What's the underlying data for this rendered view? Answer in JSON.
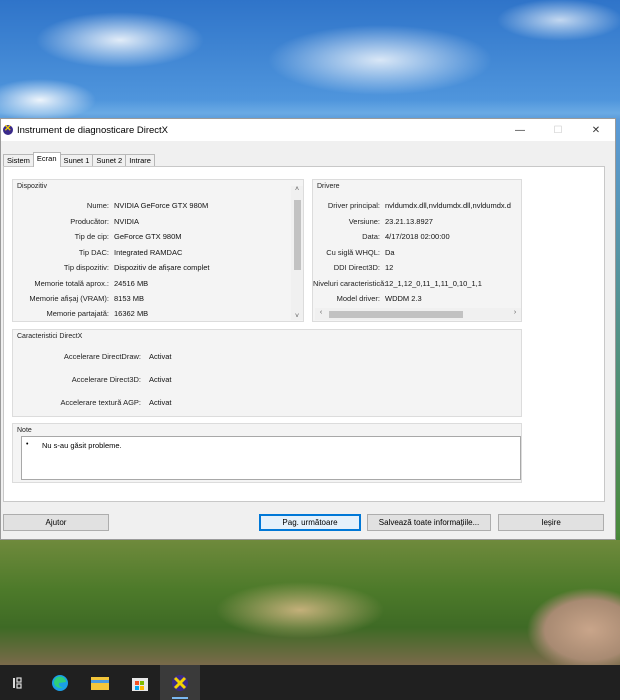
{
  "window": {
    "title": "Instrument de diagnosticare DirectX",
    "minimize": "—",
    "maximize": "☐",
    "close": "✕"
  },
  "tabs": [
    {
      "label": "Sistem",
      "active": false
    },
    {
      "label": "Ecran",
      "active": true
    },
    {
      "label": "Sunet 1",
      "active": false
    },
    {
      "label": "Sunet 2",
      "active": false
    },
    {
      "label": "Intrare",
      "active": false
    }
  ],
  "device": {
    "title": "Dispozitiv",
    "rows": [
      {
        "label": "Nume:",
        "value": "NVIDIA GeForce GTX 980M"
      },
      {
        "label": "Producător:",
        "value": "NVIDIA"
      },
      {
        "label": "Tip de cip:",
        "value": "GeForce GTX 980M"
      },
      {
        "label": "Tip DAC:",
        "value": "Integrated RAMDAC"
      },
      {
        "label": "Tip dispozitiv:",
        "value": "Dispozitiv de afișare complet"
      },
      {
        "label": "Memorie totală aprox.:",
        "value": "24516 MB"
      },
      {
        "label": "Memorie afișaj (VRAM):",
        "value": "8153 MB"
      },
      {
        "label": "Memorie partajată:",
        "value": "16362 MB"
      }
    ]
  },
  "drivers": {
    "title": "Drivere",
    "rows": [
      {
        "label": "Driver principal:",
        "value": "nvldumdx.dll,nvldumdx.dll,nvldumdx.d"
      },
      {
        "label": "Versiune:",
        "value": "23.21.13.8927"
      },
      {
        "label": "Data:",
        "value": "4/17/2018 02:00:00"
      },
      {
        "label": "Cu siglă WHQL:",
        "value": "Da"
      },
      {
        "label": "DDI Direct3D:",
        "value": "12"
      },
      {
        "label": "Niveluri caracteristică:",
        "value": "12_1,12_0,11_1,11_0,10_1,1"
      },
      {
        "label": "Model driver:",
        "value": "WDDM 2.3"
      }
    ]
  },
  "features": {
    "title": "Caracteristici DirectX",
    "rows": [
      {
        "label": "Accelerare DirectDraw:",
        "value": "Activat"
      },
      {
        "label": "Accelerare Direct3D:",
        "value": "Activat"
      },
      {
        "label": "Accelerare textură AGP:",
        "value": "Activat"
      }
    ]
  },
  "notes": {
    "title": "Note",
    "bullet": "•",
    "text": "Nu s-au găsit probleme."
  },
  "buttons": {
    "help": "Ajutor",
    "next": "Pag. următoare",
    "save": "Salvează toate informațiile...",
    "exit": "Ieșire"
  },
  "scroll": {
    "up": "˄",
    "down": "˅",
    "left": "‹",
    "right": "›"
  },
  "taskbar": {
    "items": [
      "task-view-icon",
      "edge-icon",
      "file-explorer-icon",
      "store-icon",
      "directx-icon"
    ]
  }
}
